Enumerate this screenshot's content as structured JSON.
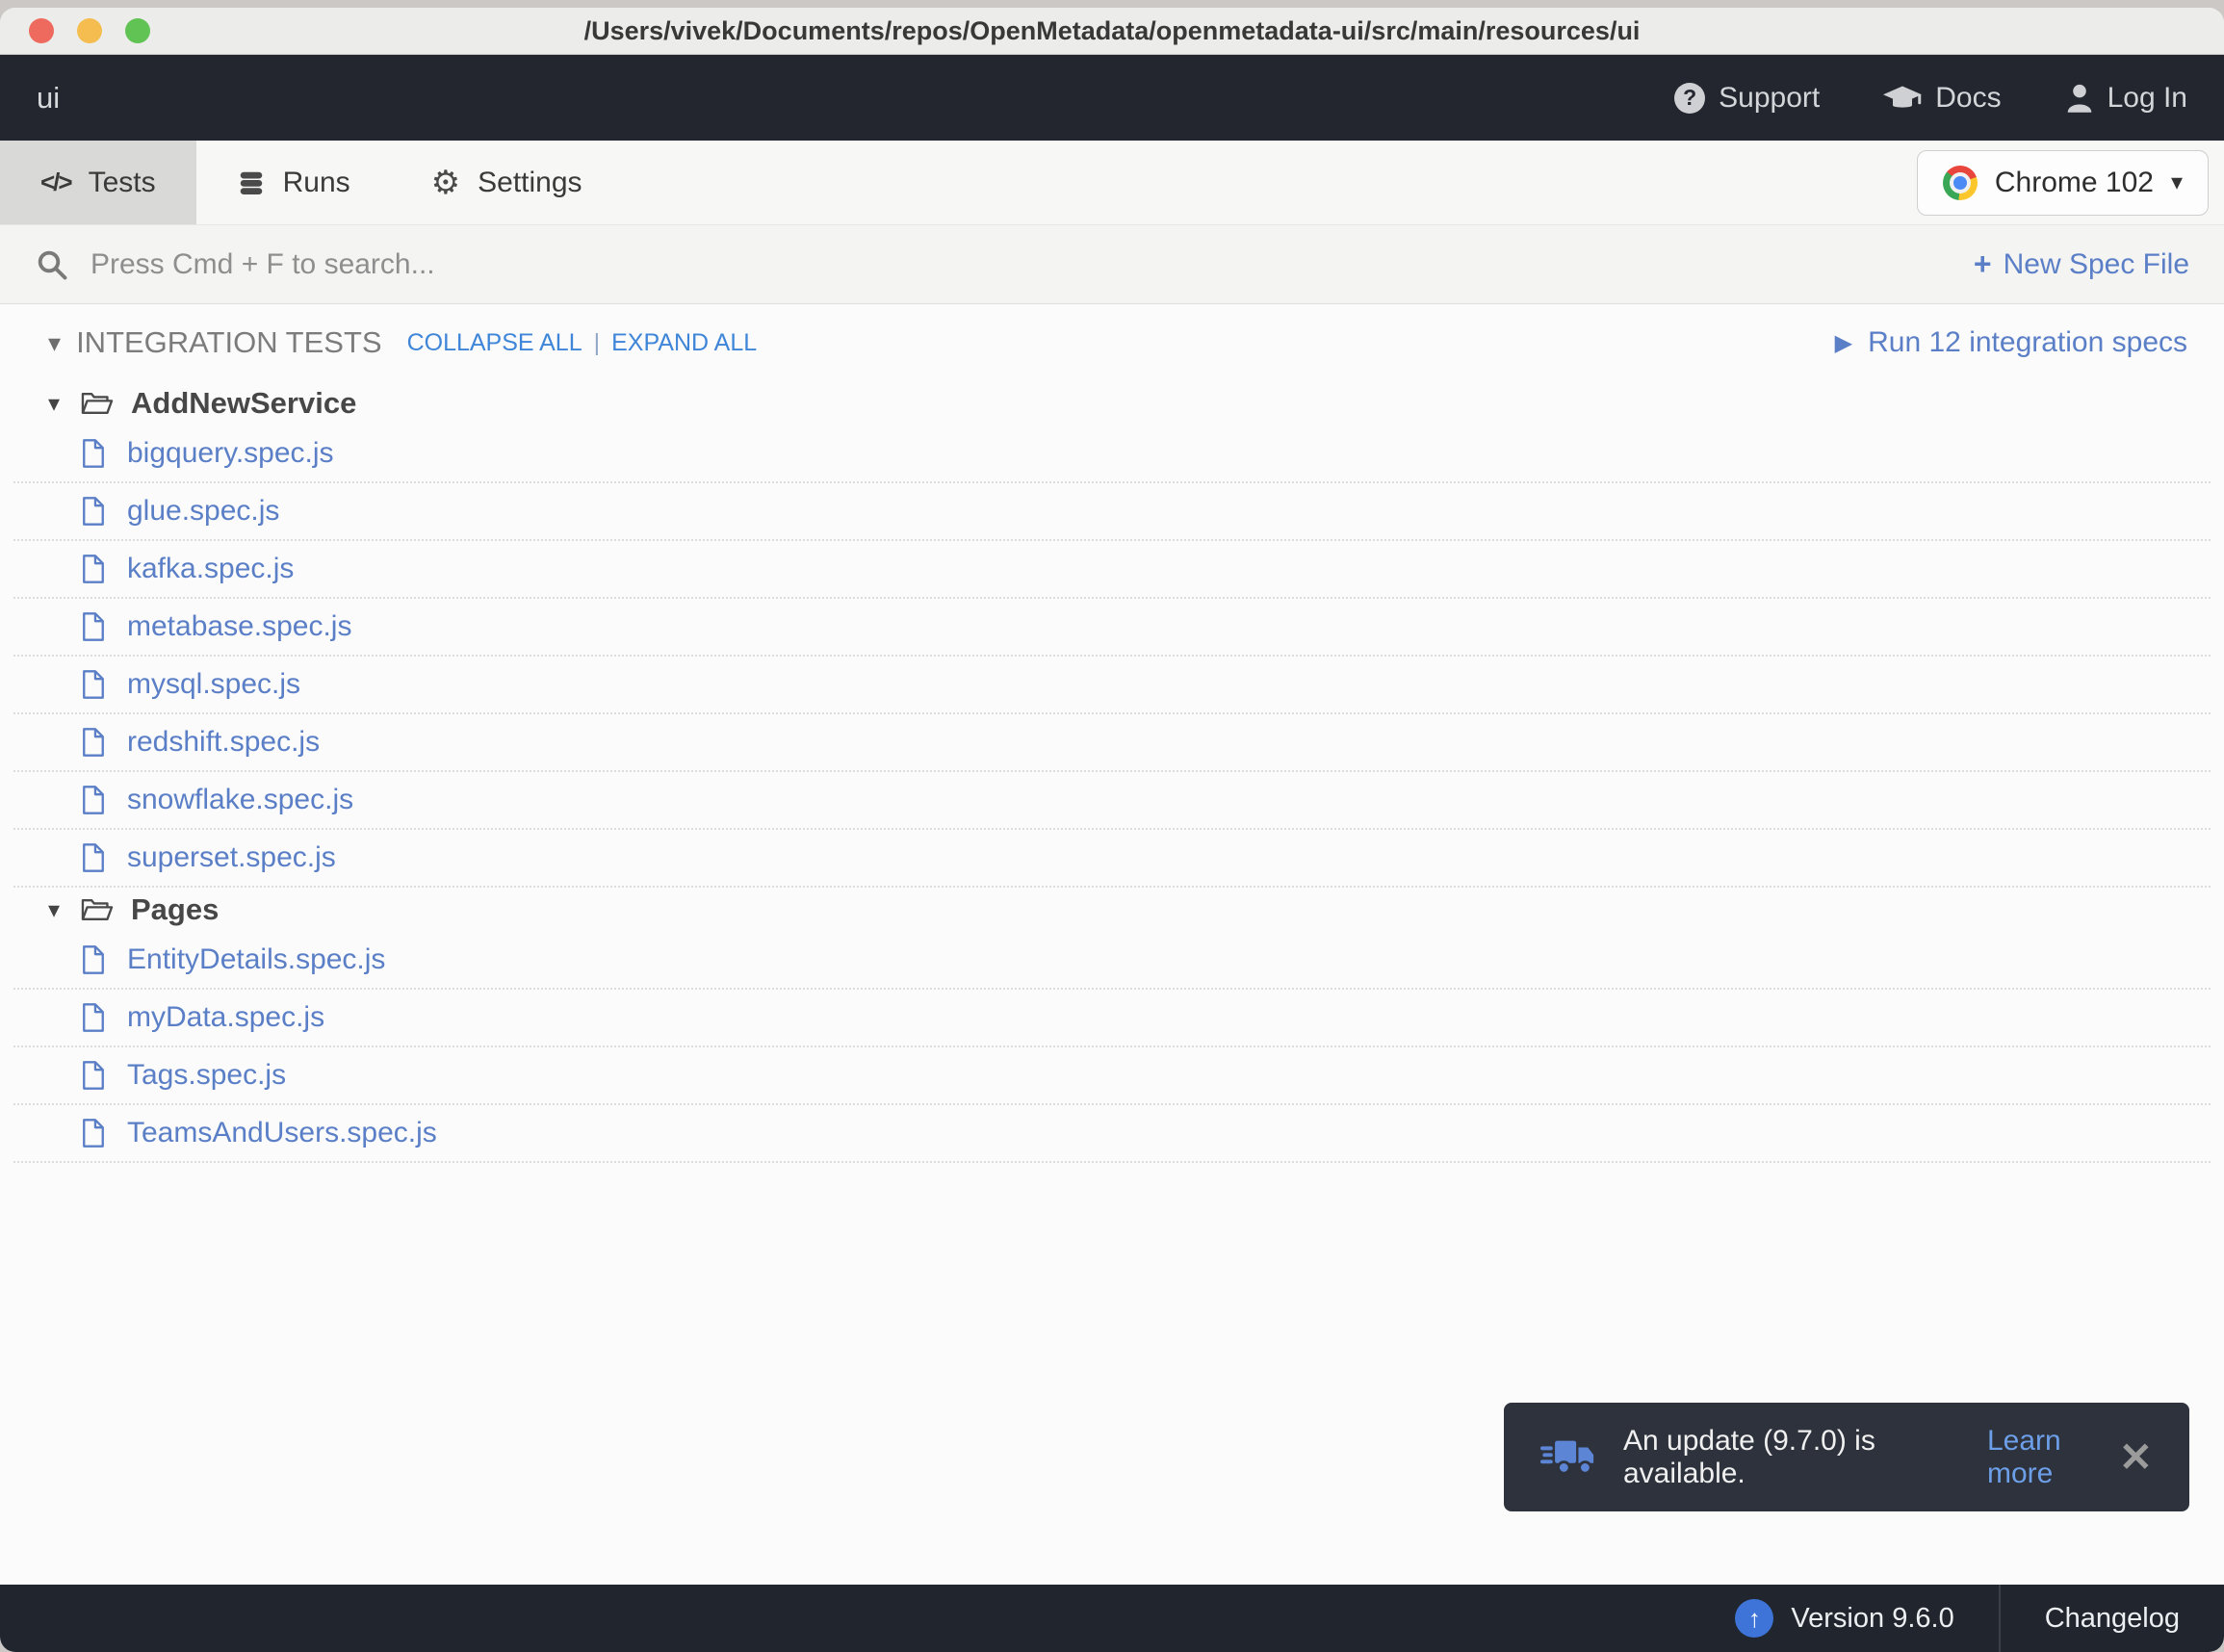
{
  "glyphs": {
    "caret_down": "▾",
    "dropdown_caret": "▾",
    "play": "▶",
    "plus": "+",
    "close": "✕",
    "question": "?",
    "up_arrow": "↑",
    "pipe": "|",
    "code": "</>",
    "gear": "⚙"
  },
  "titlebar": {
    "path": "/Users/vivek/Documents/repos/OpenMetadata/openmetadata-ui/src/main/resources/ui"
  },
  "header": {
    "project_name": "ui",
    "support_label": "Support",
    "docs_label": "Docs",
    "login_label": "Log In"
  },
  "tabs": {
    "tests_label": "Tests",
    "runs_label": "Runs",
    "settings_label": "Settings"
  },
  "browser_select": {
    "label": "Chrome 102"
  },
  "search": {
    "placeholder": "Press Cmd + F to search...",
    "value": ""
  },
  "new_spec_label": "New Spec File",
  "tests_section": {
    "title": "INTEGRATION TESTS",
    "collapse_all": "COLLAPSE ALL",
    "expand_all": "EXPAND ALL",
    "run_label": "Run 12 integration specs"
  },
  "tree": {
    "folders": [
      {
        "name": "AddNewService",
        "files": [
          "bigquery.spec.js",
          "glue.spec.js",
          "kafka.spec.js",
          "metabase.spec.js",
          "mysql.spec.js",
          "redshift.spec.js",
          "snowflake.spec.js",
          "superset.spec.js"
        ]
      },
      {
        "name": "Pages",
        "files": [
          "EntityDetails.spec.js",
          "myData.spec.js",
          "Tags.spec.js",
          "TeamsAndUsers.spec.js"
        ]
      }
    ]
  },
  "toast": {
    "message": "An update (9.7.0) is available.",
    "link_label": "Learn more"
  },
  "footer": {
    "version_label": "Version 9.6.0",
    "changelog_label": "Changelog"
  },
  "colors": {
    "header_bg": "#23262e",
    "footer_bg": "#21252d",
    "link_blue": "#5b7fc7",
    "action_blue": "#3f85d8",
    "toast_bg": "#2d323c",
    "accent_truck": "#5c85d6",
    "version_badge": "#3e74d8"
  }
}
